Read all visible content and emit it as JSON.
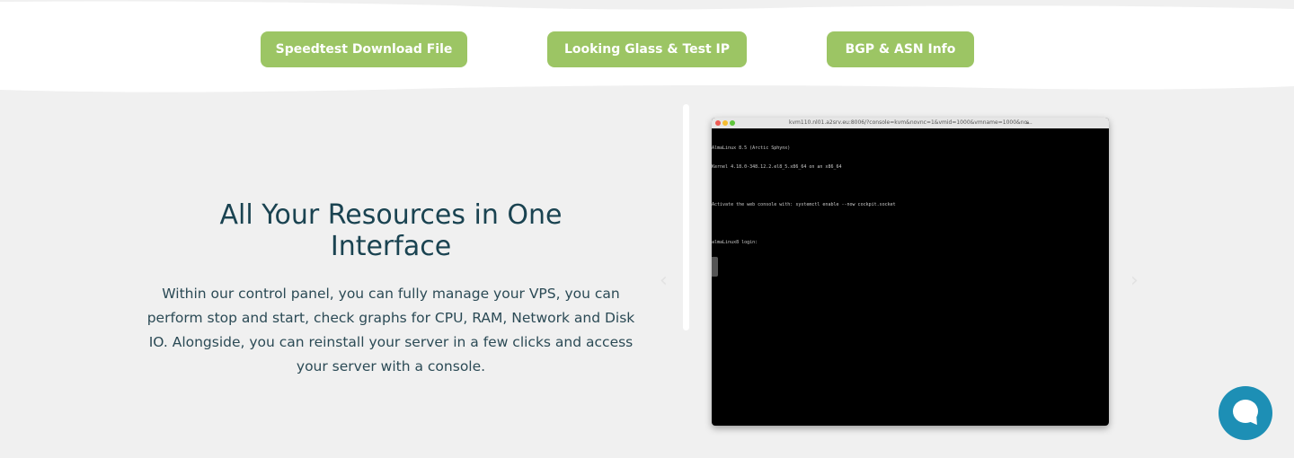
{
  "header_buttons": [
    {
      "label": "Speedtest Download File"
    },
    {
      "label": "Looking Glass & Test IP"
    },
    {
      "label": "BGP & ASN Info"
    }
  ],
  "feature": {
    "title": "All Your Resources in One Interface",
    "description": "Within our control panel, you can fully manage your VPS, you can perform stop and start, check graphs for CPU, RAM, Network and Disk IO. Alongside, you can reinstall your server in a few clicks and access your server with a console."
  },
  "console": {
    "url": "kvm110.nl01.a2srv.eu:8006/?console=kvm&novnc=1&vmid=1000&vmname=1000&no...",
    "lines": [
      "AlmaLinux 8.5 (Arctic Sphynx)",
      "Kernel 4.18.0-348.12.2.el8_5.x86_64 on an x86_64",
      "Activate the web console with: systemctl enable --now cockpit.socket",
      "almaLinux8 login:"
    ]
  },
  "carousel": {
    "prev_icon": "chevron-left-icon",
    "next_icon": "chevron-right-icon",
    "prev_glyph": "‹",
    "next_glyph": "›"
  },
  "chat": {
    "icon": "chat-bubble-icon"
  },
  "colors": {
    "button_green": "#9cc564",
    "heading": "#1a4351",
    "background": "#f0f0f0",
    "chat_blue": "#1d8fb5"
  }
}
